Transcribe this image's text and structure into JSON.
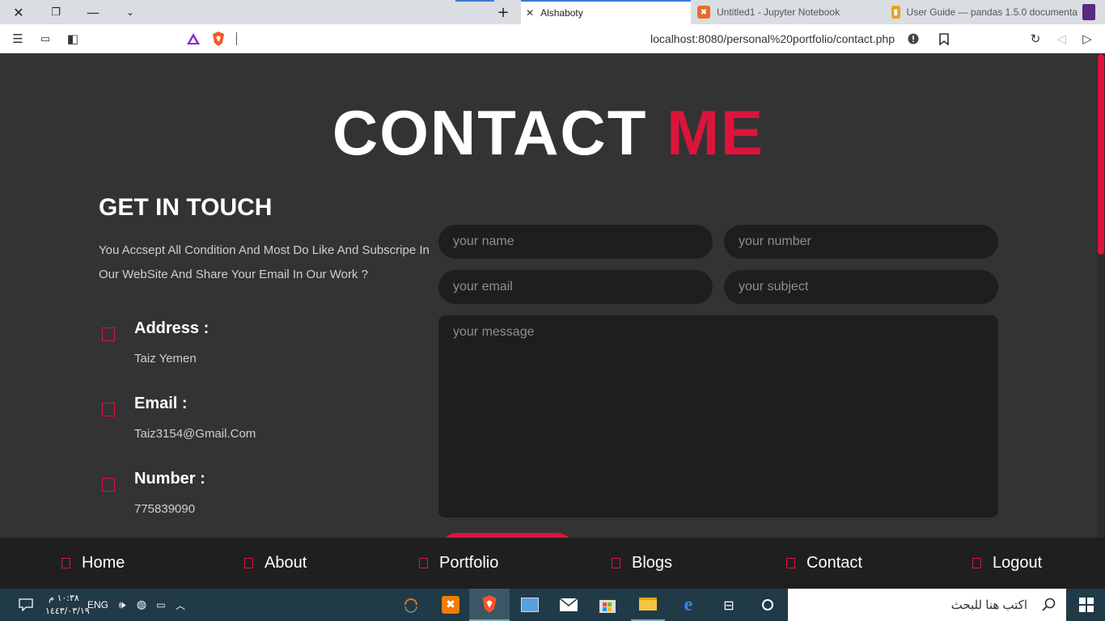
{
  "browser": {
    "tabs": [
      {
        "title": "Alshaboty",
        "active": true
      },
      {
        "title": "Untitled1 - Jupyter Notebook",
        "active": false
      },
      {
        "title": "User Guide — pandas 1.5.0 documenta",
        "active": false
      }
    ],
    "url": "localhost:8080/personal%20portfolio/contact.php"
  },
  "page": {
    "heading_main": "CONTACT",
    "heading_accent": "ME",
    "get_in_touch": "GET IN TOUCH",
    "intro": "You Accsept All Condition And Most Do Like And Subscripe In Our WebSite And Share Your Email In Our Work ?",
    "info": [
      {
        "label": "Address :",
        "value": "Taiz Yemen"
      },
      {
        "label": "Email :",
        "value": "Taiz3154@Gmail.Com"
      },
      {
        "label": "Number :",
        "value": "775839090"
      }
    ],
    "form": {
      "name_placeholder": "your name",
      "number_placeholder": "your number",
      "email_placeholder": "your email",
      "subject_placeholder": "your subject",
      "message_placeholder": "your message"
    }
  },
  "footer": {
    "nav": [
      "Home",
      "About",
      "Portfolio",
      "Blogs",
      "Contact",
      "Logout"
    ]
  },
  "taskbar": {
    "search_placeholder": "اكتب هنا للبحث",
    "time": "١٠:٣٨ م",
    "date": "١٤٤٣/٠٣/١٩",
    "language": "ENG"
  },
  "colors": {
    "accent": "#dc143c",
    "background": "#333333",
    "footer": "#1f1f1f"
  }
}
